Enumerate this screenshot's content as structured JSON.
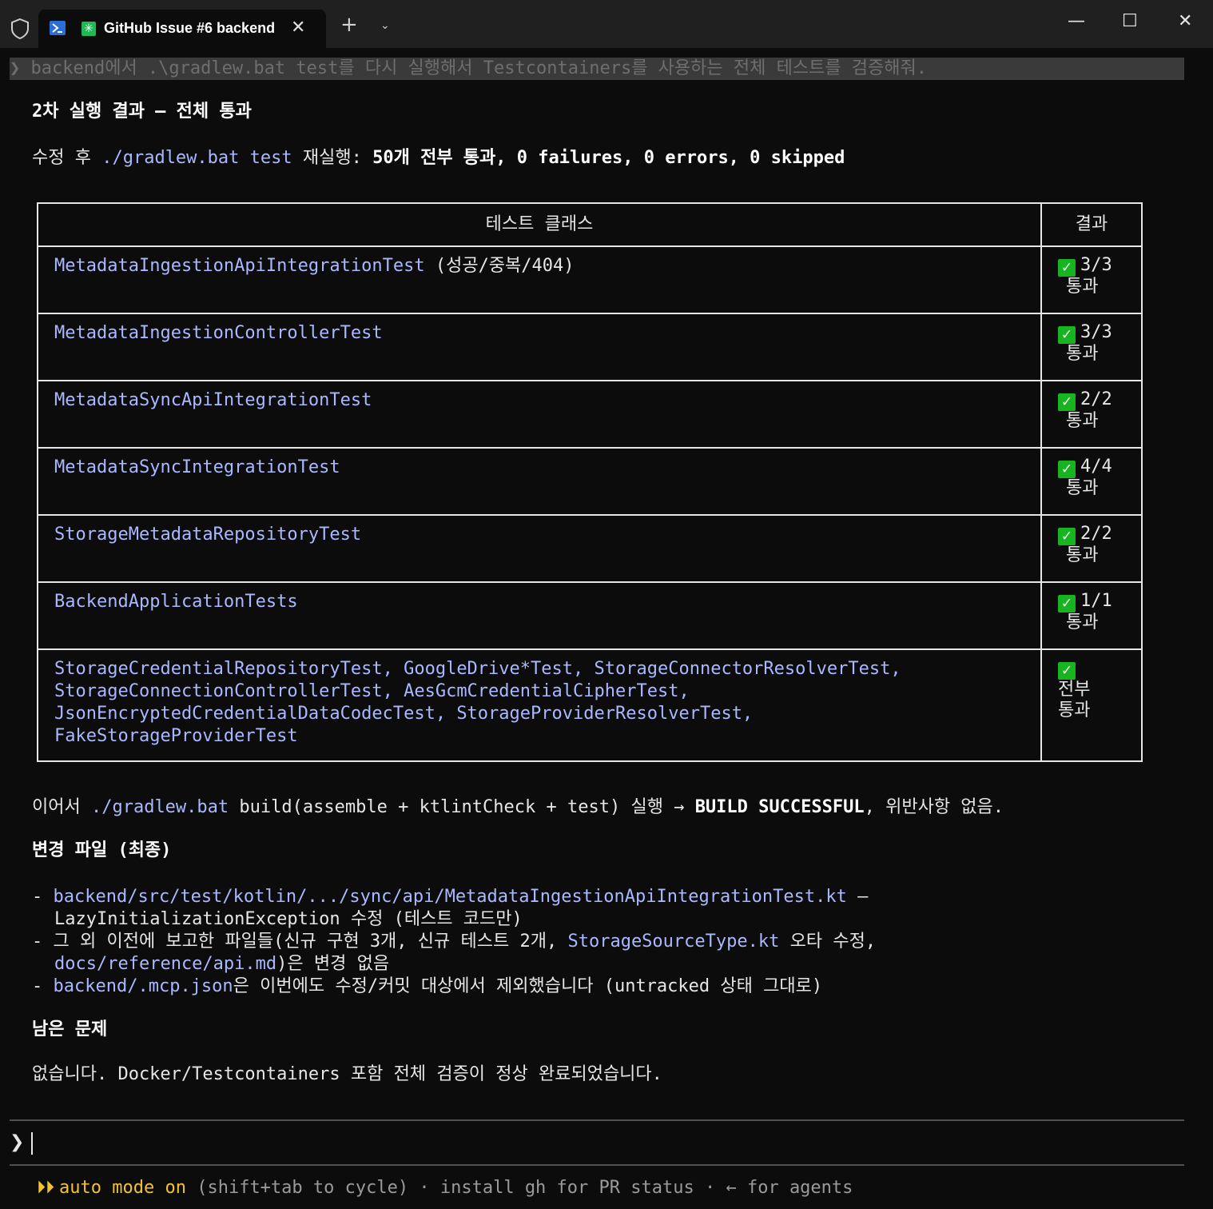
{
  "window": {
    "tab_title": "GitHub Issue #6 backend",
    "controls": {
      "minimize": "—",
      "maximize": "☐",
      "close": "✕"
    }
  },
  "terminal": {
    "previous_command": "❯ backend에서 .\\gradlew.bat test를 다시 실행해서 Testcontainers를 사용하는 전체 테스트를 검증해줘.",
    "heading": "2차 실행 결과 — 전체 통과",
    "summary": {
      "prefix": "수정 후 ",
      "command": "./gradlew.bat test",
      "middle": " 재실행: ",
      "count": "50개 전부 통과, 0 failures, 0 errors, 0 skipped"
    },
    "table": {
      "headers": [
        "테스트 클래스",
        "결과"
      ],
      "rows": [
        {
          "name": "MetadataIngestionApiIntegrationTest",
          "suffix": " (성공/중복/404)",
          "result": "3/3",
          "status": "통과"
        },
        {
          "name": "MetadataIngestionControllerTest",
          "suffix": "",
          "result": "3/3",
          "status": "통과"
        },
        {
          "name": "MetadataSyncApiIntegrationTest",
          "suffix": "",
          "result": "2/2",
          "status": "통과"
        },
        {
          "name": "MetadataSyncIntegrationTest",
          "suffix": "",
          "result": "4/4",
          "status": "통과"
        },
        {
          "name": "StorageMetadataRepositoryTest",
          "suffix": "",
          "result": "2/2",
          "status": "통과"
        },
        {
          "name": "BackendApplicationTests",
          "suffix": "",
          "result": "1/1",
          "status": "통과"
        }
      ],
      "last_row": {
        "lines": [
          "StorageCredentialRepositoryTest, GoogleDrive*Test, StorageConnectorResolverTest,",
          "StorageConnectionControllerTest, AesGcmCredentialCipherTest,",
          "JsonEncryptedCredentialDataCodecTest, StorageProviderResolverTest,",
          "FakeStorageProviderTest"
        ],
        "result_line1": "전부",
        "result_line2": "통과"
      }
    },
    "build": {
      "prefix": "이어서 ",
      "command": "./gradlew.bat",
      "args": " build(assemble + ktlintCheck + test) 실행 → ",
      "result": "BUILD SUCCESSFUL",
      "suffix": ", 위반사항 없음."
    },
    "changed_files": {
      "heading": "변경 파일 (최종)",
      "item1_path": "backend/src/test/kotlin/.../sync/api/MetadataIngestionApiIntegrationTest.kt",
      "item1_dash": " —",
      "item1_desc": "LazyInitializationException 수정 (테스트 코드만)",
      "item2_text": "그 외 이전에 보고한 파일들(신규 구현 3개, 신규 테스트 2개, ",
      "item2_code": "StorageSourceType.kt",
      "item2_tail": " 오타 수정,",
      "item2_cont_code": "docs/reference/api.md",
      "item2_cont_tail": ")은 변경 없음",
      "item3_code": "backend/.mcp.json",
      "item3_tail": "은 이번에도 수정/커밋 대상에서 제외했습니다 (untracked 상태 그대로)"
    },
    "remaining": {
      "heading": "남은 문제",
      "text": "없습니다. Docker/Testcontainers 포함 전체 검증이 정상 완료되었습니다."
    },
    "prompt_symbol": "❯",
    "status_bar": {
      "arrows": "⏵⏵",
      "mode": "auto mode on",
      "hint": " (shift+tab to cycle) · install gh for PR status · ← for agents"
    }
  }
}
